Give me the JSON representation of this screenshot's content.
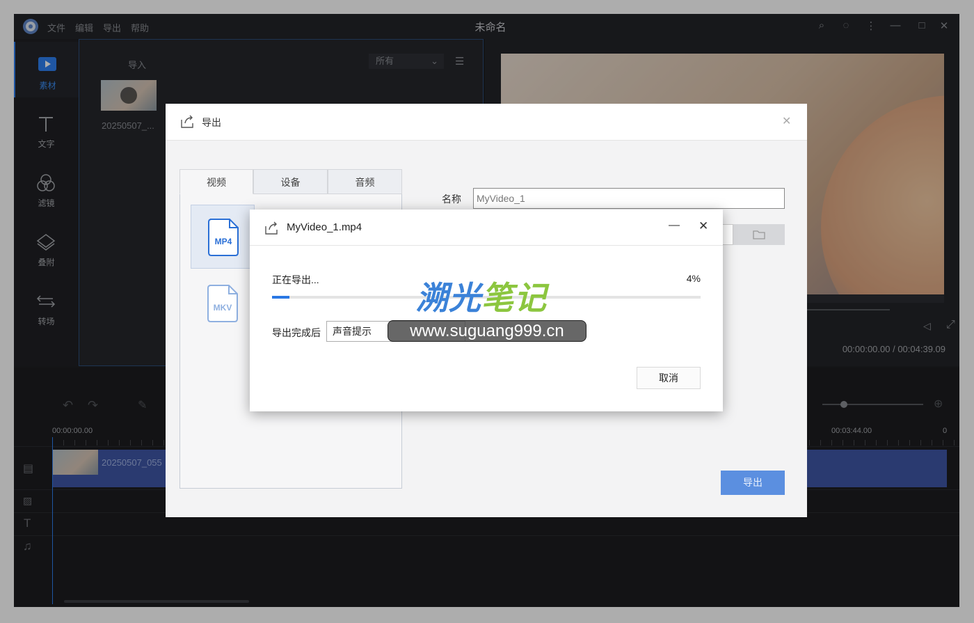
{
  "app": {
    "title": "未命名",
    "menu": [
      "文件",
      "编辑",
      "导出",
      "帮助"
    ],
    "sidebar": [
      "素材",
      "文字",
      "滤镜",
      "叠附",
      "转场"
    ],
    "media": {
      "import_label": "导入",
      "filter_value": "所有",
      "clip_name": "20250507_..."
    },
    "preview": {
      "timecode": "00:00:00.00 / 00:04:39.09"
    },
    "timeline": {
      "ruler_start": "00:00:00.00",
      "ruler_mid": "00:03:44.00",
      "ruler_end": "0",
      "clip_label": "20250507_055"
    }
  },
  "export_dialog": {
    "title": "导出",
    "tabs": [
      "视频",
      "设备",
      "音频"
    ],
    "formats": [
      "MP4",
      "MKV"
    ],
    "name_label": "名称",
    "name_value": "MyVideo_1",
    "export_button": "导出"
  },
  "progress_dialog": {
    "title": "MyVideo_1.mp4",
    "status": "正在导出...",
    "percent_text": "4%",
    "progress": 0.04,
    "after_label": "导出完成后",
    "after_value": "声音提示",
    "cancel_label": "取消"
  },
  "watermark": {
    "title": "溯光笔记",
    "url": "www.suguang999.cn"
  },
  "colors": {
    "accent": "#2f7ff0",
    "progress": "#2a78e4",
    "watermark_blue": "#3b82d8",
    "watermark_green": "#8cc63f"
  }
}
